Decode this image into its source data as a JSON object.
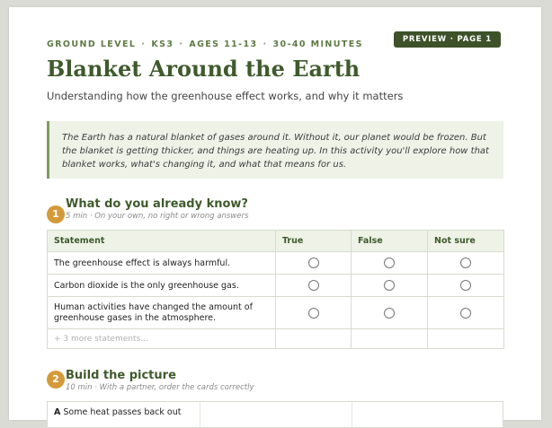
{
  "meta": {
    "level": "GROUND LEVEL",
    "stage": "KS3",
    "ages": "AGES 11-13",
    "duration": "30-40 MINUTES",
    "separator": "·"
  },
  "badge": "PREVIEW · PAGE 1",
  "title": "Blanket Around the Earth",
  "subtitle": "Understanding how the greenhouse effect works, and why it matters",
  "intro": "The Earth has a natural blanket of gases around it. Without it, our planet would be frozen. But the blanket is getting thicker, and things are heating up. In this activity you'll explore how that blanket works, what's changing it, and what that means for us.",
  "section1": {
    "number": "1",
    "title": "What do you already know?",
    "subtitle": "5 min · On your own, no right or wrong answers",
    "columns": [
      "Statement",
      "True",
      "False",
      "Not sure"
    ],
    "rows": [
      "The greenhouse effect is always harmful.",
      "Carbon dioxide is the only greenhouse gas.",
      "Human activities have changed the amount of greenhouse gases in the atmosphere."
    ],
    "more": "+ 3 more statements..."
  },
  "section2": {
    "number": "2",
    "title": "Build the picture",
    "subtitle": "10 min · With a partner, order the cards correctly",
    "card_letter": "A",
    "card_text": "Some heat passes back out"
  },
  "colors": {
    "accent": "#3f5a2c",
    "badge": "#3d5229",
    "section_number": "#d49a3a",
    "intro_bg": "#eef2e7"
  }
}
